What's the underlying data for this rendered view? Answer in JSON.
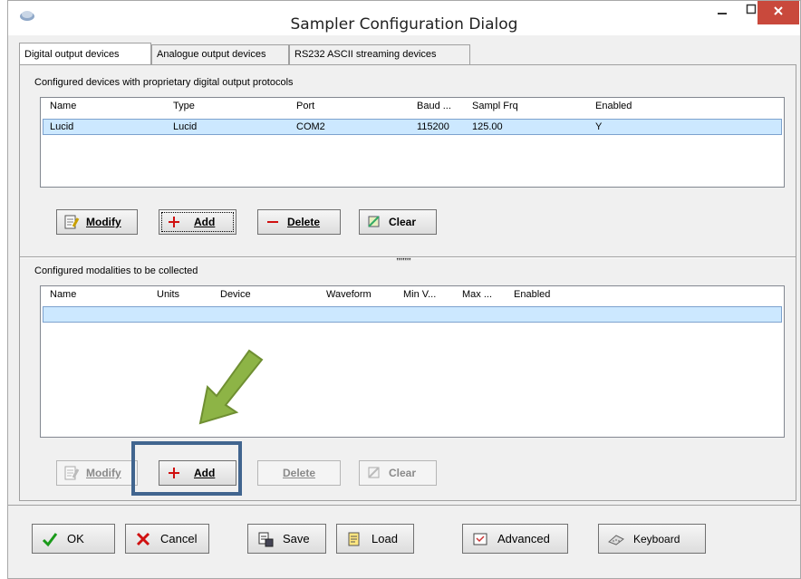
{
  "window": {
    "title": "Sampler Configuration Dialog"
  },
  "tabs": [
    {
      "label": "Digital output devices"
    },
    {
      "label": "Analogue output devices"
    },
    {
      "label": "RS232 ASCII streaming devices"
    }
  ],
  "devices": {
    "section_label": "Configured devices with proprietary digital output protocols",
    "columns": [
      "Name",
      "Type",
      "Port",
      "Baud ...",
      "Sampl Frq",
      "Enabled"
    ],
    "rows": [
      {
        "name": "Lucid",
        "type": "Lucid",
        "port": "COM2",
        "baud": "115200",
        "sampl_frq": "125.00",
        "enabled": "Y"
      }
    ],
    "buttons": {
      "modify": "Modify",
      "add": "Add",
      "delete": "Delete",
      "clear": "Clear"
    }
  },
  "modalities": {
    "section_label": "Configured modalities to be collected",
    "columns": [
      "Name",
      "Units",
      "Device",
      "Waveform",
      "Min V...",
      "Max ...",
      "Enabled"
    ],
    "buttons": {
      "modify": "Modify",
      "add": "Add",
      "delete": "Delete",
      "clear": "Clear"
    }
  },
  "footer": {
    "ok": "OK",
    "cancel": "Cancel",
    "save": "Save",
    "load": "Load",
    "advanced": "Advanced",
    "keyboard": "Keyboard"
  },
  "colors": {
    "close_button": "#c9493c",
    "selection": "#cce8ff",
    "callout_arrow": "#8db446",
    "highlight_box": "#41658f"
  }
}
